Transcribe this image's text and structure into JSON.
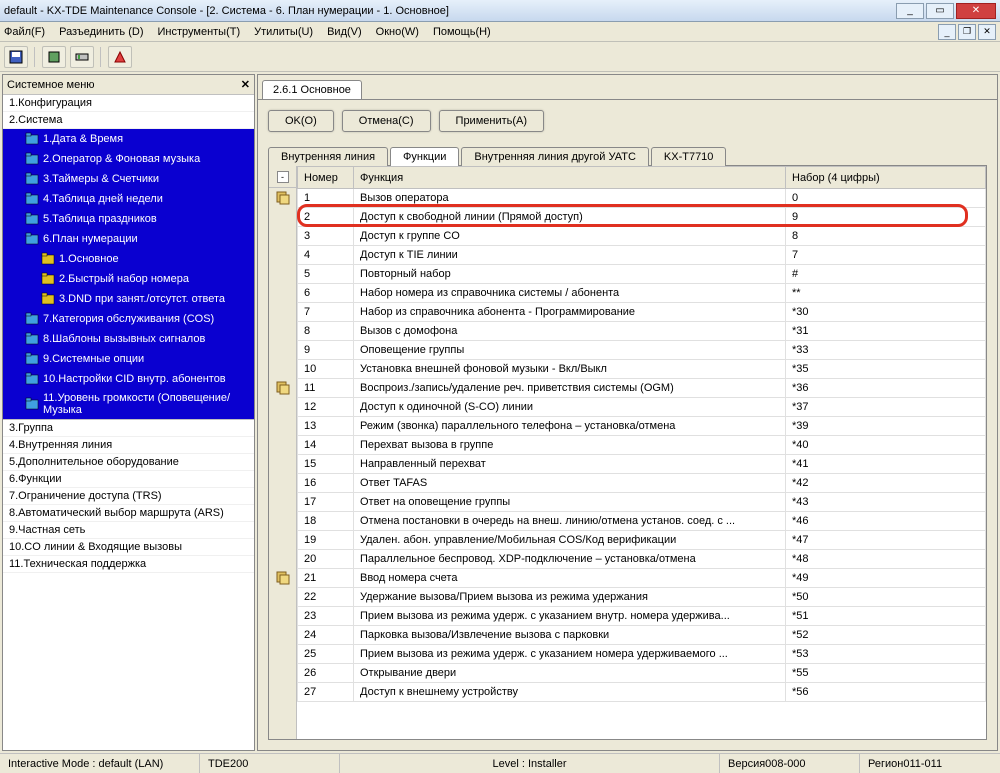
{
  "title": "default - KX-TDE Maintenance Console - [2. Система - 6. План нумерации - 1. Основное]",
  "menu": [
    "Файл(F)",
    "Разъединить (D)",
    "Инструменты(T)",
    "Утилиты(U)",
    "Вид(V)",
    "Окно(W)",
    "Помощь(H)"
  ],
  "sidebar": {
    "title": "Системное меню",
    "roots_before": [
      "1.Конфигурация",
      "2.Система"
    ],
    "items": [
      {
        "label": "1.Дата & Время",
        "l": 1
      },
      {
        "label": "2.Оператор & Фоновая музыка",
        "l": 1
      },
      {
        "label": "3.Таймеры & Счетчики",
        "l": 1
      },
      {
        "label": "4.Таблица дней недели",
        "l": 1
      },
      {
        "label": "5.Таблица праздников",
        "l": 1
      },
      {
        "label": "6.План нумерации",
        "l": 1
      },
      {
        "label": "1.Основное",
        "l": 2
      },
      {
        "label": "2.Быстрый набор номера",
        "l": 2
      },
      {
        "label": "3.DND при занят./отсутст. ответа",
        "l": 2
      },
      {
        "label": "7.Категория обслуживания (COS)",
        "l": 1
      },
      {
        "label": "8.Шаблоны вызывных сигналов",
        "l": 1
      },
      {
        "label": "9.Системные опции",
        "l": 1
      },
      {
        "label": "10.Настройки CID внутр. абонентов",
        "l": 1
      },
      {
        "label": "11.Уровень громкости (Оповещение/Музыка",
        "l": 1
      }
    ],
    "roots_after": [
      "3.Группа",
      "4.Внутренняя линия",
      "5.Дополнительное оборудование",
      "6.Функции",
      "7.Ограничение доступа (TRS)",
      "8.Автоматический выбор маршрута (ARS)",
      "9.Частная сеть",
      "10.CO линии & Входящие вызовы",
      "11.Техническая поддержка"
    ]
  },
  "content": {
    "tab": "2.6.1 Основное",
    "buttons": {
      "ok": "OK(O)",
      "cancel": "Отмена(C)",
      "apply": "Применить(A)"
    },
    "subtabs": [
      "Внутренняя линия",
      "Функции",
      "Внутренняя линия другой УАТС",
      "KX-T7710"
    ],
    "subtab_active": 1,
    "cols": [
      "Номер",
      "Функция",
      "Набор (4 цифры)"
    ],
    "highlight_row": 1,
    "rows": [
      {
        "n": "1",
        "f": "Вызов оператора",
        "d": "0"
      },
      {
        "n": "2",
        "f": "Доступ к свободной линии (Прямой доступ)",
        "d": "9"
      },
      {
        "n": "3",
        "f": "Доступ к группе CO",
        "d": "8"
      },
      {
        "n": "4",
        "f": "Доступ к TIE линии",
        "d": "7"
      },
      {
        "n": "5",
        "f": "Повторный набор",
        "d": "#"
      },
      {
        "n": "6",
        "f": "Набор номера из справочника системы / абонента",
        "d": "**"
      },
      {
        "n": "7",
        "f": "Набор из справочника абонента - Программирование",
        "d": "*30"
      },
      {
        "n": "8",
        "f": "Вызов с домофона",
        "d": "*31"
      },
      {
        "n": "9",
        "f": "Оповещение группы",
        "d": "*33"
      },
      {
        "n": "10",
        "f": "Установка внешней фоновой музыки - Вкл/Выкл",
        "d": "*35"
      },
      {
        "n": "11",
        "f": "Воспроиз./запись/удаление реч. приветствия системы (OGM)",
        "d": "*36"
      },
      {
        "n": "12",
        "f": "Доступ к одиночной (S-CO) линии",
        "d": "*37"
      },
      {
        "n": "13",
        "f": "Режим (звонка) параллельного телефона – установка/отмена",
        "d": "*39"
      },
      {
        "n": "14",
        "f": "Перехват вызова в группе",
        "d": "*40"
      },
      {
        "n": "15",
        "f": "Направленный перехват",
        "d": "*41"
      },
      {
        "n": "16",
        "f": "Ответ TAFAS",
        "d": "*42"
      },
      {
        "n": "17",
        "f": "Ответ на оповещение группы",
        "d": "*43"
      },
      {
        "n": "18",
        "f": "Отмена постановки в очередь на внеш. линию/отмена установ. соед. с ...",
        "d": "*46"
      },
      {
        "n": "19",
        "f": "Удален. абон. управление/Мобильная COS/Код верификации",
        "d": "*47"
      },
      {
        "n": "20",
        "f": "Параллельное беспровод. XDP-подключение – установка/отмена",
        "d": "*48"
      },
      {
        "n": "21",
        "f": "Ввод номера счета",
        "d": "*49"
      },
      {
        "n": "22",
        "f": "Удержание вызова/Прием вызова из режима удержания",
        "d": "*50"
      },
      {
        "n": "23",
        "f": "Прием вызова из режима удерж. с указанием внутр. номера удержива...",
        "d": "*51"
      },
      {
        "n": "24",
        "f": "Парковка вызова/Извлечение вызова с парковки",
        "d": "*52"
      },
      {
        "n": "25",
        "f": "Прием вызова из режима удерж. с указанием номера удерживаемого ...",
        "d": "*53"
      },
      {
        "n": "26",
        "f": "Открывание двери",
        "d": "*55"
      },
      {
        "n": "27",
        "f": "Доступ к внешнему устройству",
        "d": "*56"
      }
    ],
    "card_rows": [
      0,
      10,
      20
    ]
  },
  "status": {
    "mode": "Interactive Mode : default (LAN)",
    "dev": "TDE200",
    "level": "Level : Installer",
    "ver": "Версия008-000",
    "region": "Регион011-011"
  }
}
